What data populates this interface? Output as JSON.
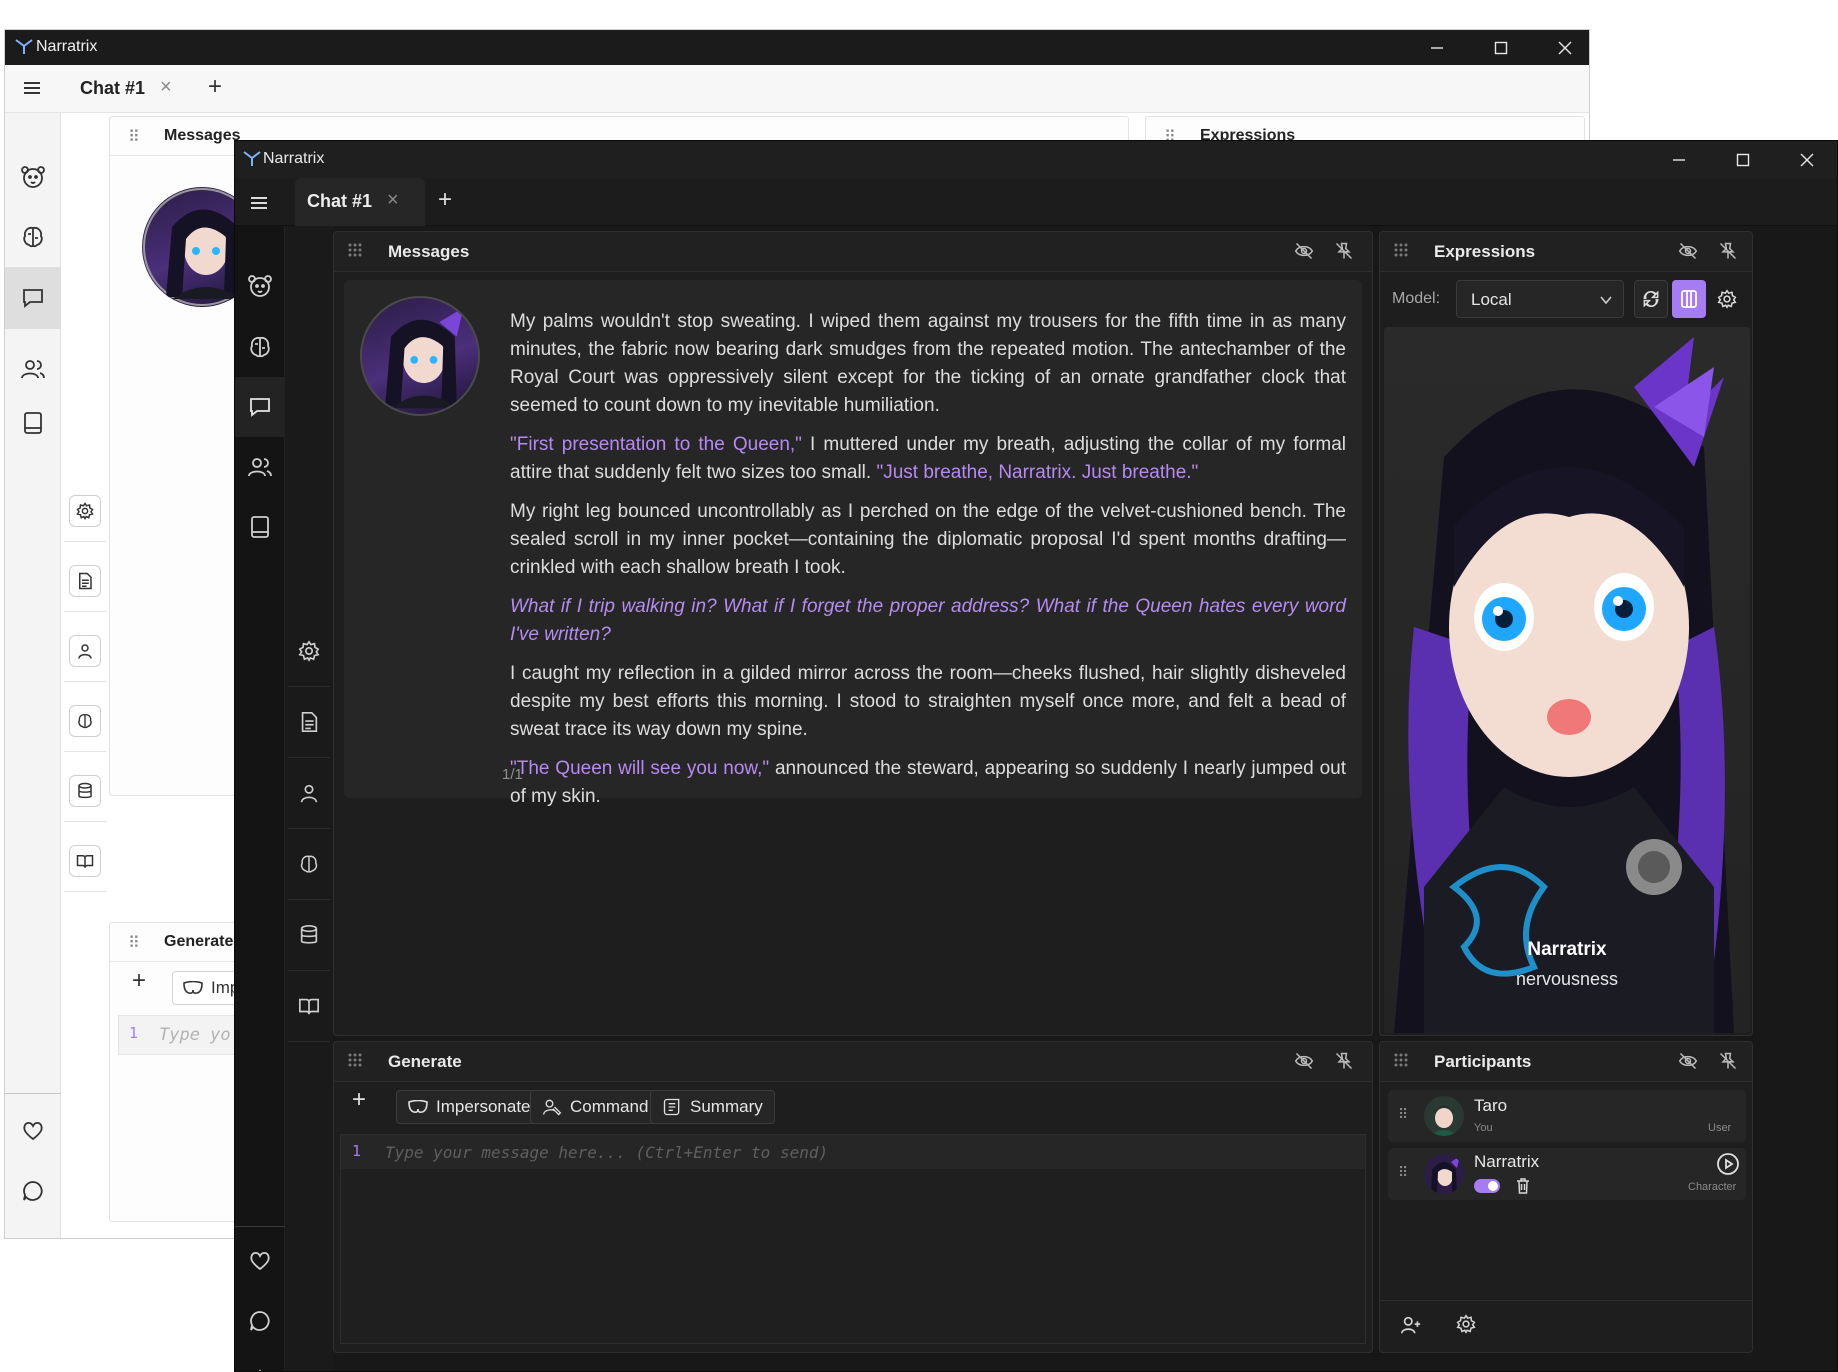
{
  "app": {
    "title": "Narratrix",
    "tab_label": "Chat #1",
    "tab_close": "×",
    "tab_add": "+"
  },
  "colors": {
    "accent": "#a57cf2",
    "dark_bg": "#181818",
    "panel_bg": "#1e1e1e",
    "quote": "#b68af0"
  },
  "back_window": {
    "panels": {
      "messages": "Messages",
      "expressions": "Expressions",
      "generate": "Generate",
      "impersonate_partial": "Imp",
      "placeholder_partial": "Type yo",
      "line_number": "1"
    }
  },
  "sidebar": {
    "items": [
      "bear-icon",
      "brain-icon",
      "chat-icon",
      "users-icon",
      "book-icon"
    ],
    "bottom": [
      "heart-icon",
      "comment-icon",
      "settings-icon"
    ]
  },
  "tool_column": [
    "gear-icon",
    "document-icon",
    "user-icon",
    "brain-icon",
    "database-icon",
    "open-book-icon"
  ],
  "messages_panel": {
    "title": "Messages",
    "page_indicator": "1/1",
    "paragraphs": [
      [
        {
          "t": "n",
          "s": "My palms wouldn't stop sweating. I wiped them against my trousers for the fifth time in as many minutes, the fabric now bearing dark smudges from the repeated motion. The antechamber of the Royal Court was oppressively silent except for the ticking of an ornate grandfather clock that seemed to count down to my inevitable humiliation."
        }
      ],
      [
        {
          "t": "q",
          "s": "\"First presentation to the Queen,\""
        },
        {
          "t": "n",
          "s": " I muttered under my breath, adjusting the collar of my formal attire that suddenly felt two sizes too small. "
        },
        {
          "t": "q",
          "s": "\"Just breathe, Narratrix. Just breathe.\""
        }
      ],
      [
        {
          "t": "n",
          "s": "My right leg bounced uncontrollably as I perched on the edge of the velvet-cushioned bench. The sealed scroll in my inner pocket—containing the diplomatic proposal I'd spent months drafting—crinkled with each shallow breath I took."
        }
      ],
      [
        {
          "t": "i",
          "s": "What if I trip walking in? What if I forget the proper address? What if the Queen hates every word I've written?"
        }
      ],
      [
        {
          "t": "n",
          "s": "I caught my reflection in a gilded mirror across the room—cheeks flushed, hair slightly disheveled despite my best efforts this morning. I stood to straighten myself once more, and felt a bead of sweat trace its way down my spine."
        }
      ],
      [
        {
          "t": "q",
          "s": "\"The Queen will see you now,\""
        },
        {
          "t": "n",
          "s": " announced the steward, appearing so suddenly I nearly jumped out of my skin."
        }
      ]
    ]
  },
  "expressions_panel": {
    "title": "Expressions",
    "model_label": "Model:",
    "model_value": "Local",
    "character_name": "Narratrix",
    "expression": "nervousness"
  },
  "generate_panel": {
    "title": "Generate",
    "add": "+",
    "buttons": [
      "Impersonate",
      "Command",
      "Summary"
    ],
    "line_number": "1",
    "placeholder": "Type your message here... (Ctrl+Enter to send)"
  },
  "participants_panel": {
    "title": "Participants",
    "participants": [
      {
        "name": "Taro",
        "sub": "You",
        "role": "User"
      },
      {
        "name": "Narratrix",
        "sub": "",
        "role": "Character"
      }
    ]
  }
}
